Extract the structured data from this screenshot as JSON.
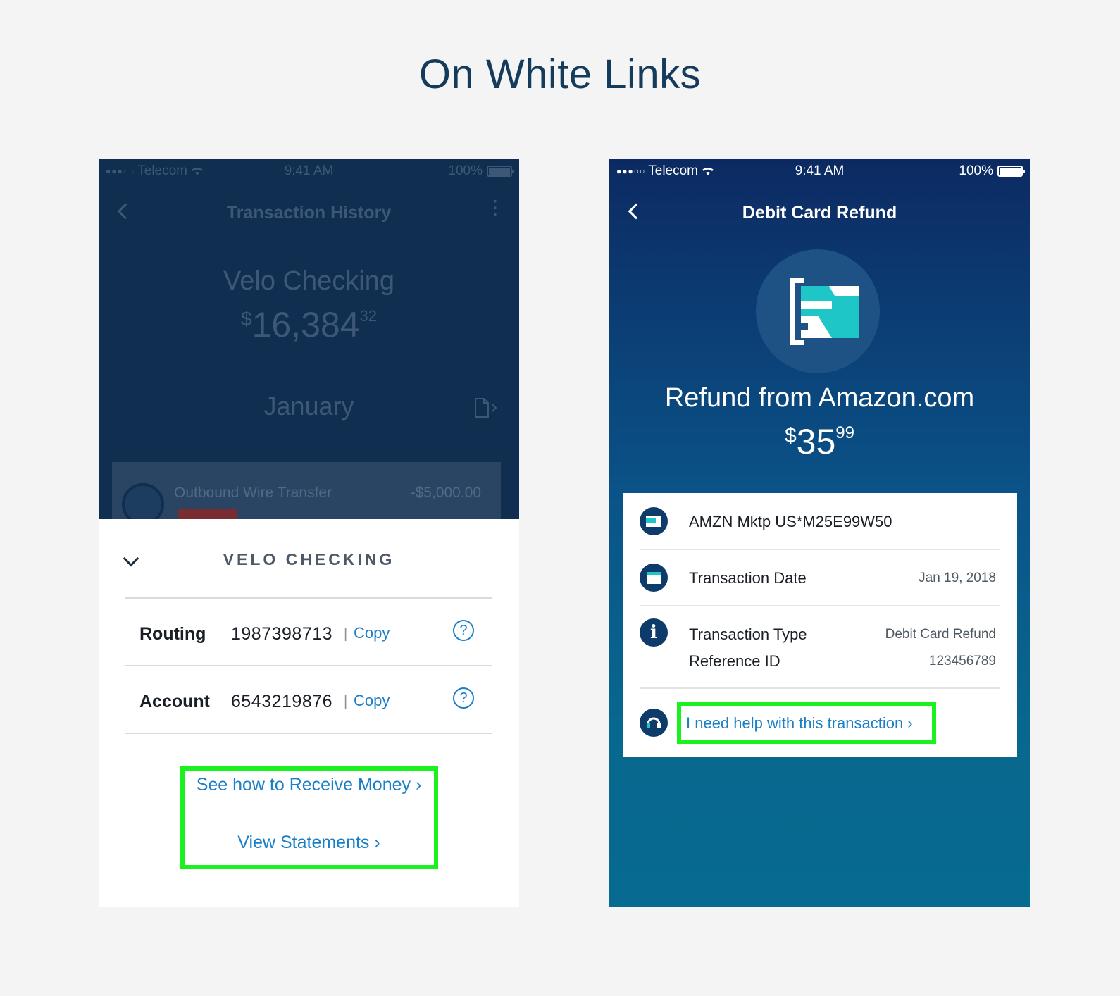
{
  "page": {
    "title": "On White Links"
  },
  "colors": {
    "link": "#1a7fc6",
    "highlight": "#19f21f",
    "title": "#143a5c"
  },
  "left_phone": {
    "status": {
      "carrier": "Telecom",
      "time": "9:41 AM",
      "battery": "100%"
    },
    "nav": {
      "title": "Transaction History",
      "back_icon": "chevron-left-icon",
      "menu_icon": "more-vertical-icon"
    },
    "account": {
      "name": "Velo Checking",
      "currency": "$",
      "whole": "16,384",
      "cents": "32"
    },
    "month": "January",
    "transaction": {
      "name": "Outbound Wire Transfer",
      "amount": "-$5,000.00"
    },
    "sheet": {
      "title": "VELO CHECKING",
      "rows": [
        {
          "label": "Routing",
          "number": "1987398713",
          "sep": "|",
          "copy": "Copy",
          "help": "?"
        },
        {
          "label": "Account",
          "number": "6543219876",
          "sep": "|",
          "copy": "Copy",
          "help": "?"
        }
      ],
      "links": [
        {
          "label": "See how to Receive Money ›"
        },
        {
          "label": "View Statements ›"
        }
      ]
    }
  },
  "right_phone": {
    "status": {
      "carrier": "Telecom",
      "time": "9:41 AM",
      "battery": "100%"
    },
    "nav": {
      "title": "Debit Card Refund"
    },
    "refund": {
      "title": "Refund from Amazon.com",
      "currency": "$",
      "whole": "35",
      "cents": "99"
    },
    "details": {
      "merchant": "AMZN Mktp US*M25E99W50",
      "date_label": "Transaction Date",
      "date_value": "Jan 19, 2018",
      "type_label": "Transaction Type",
      "type_value": "Debit Card Refund",
      "ref_label": "Reference ID",
      "ref_value": "123456789",
      "help_link": "I need help with this transaction ›"
    }
  }
}
